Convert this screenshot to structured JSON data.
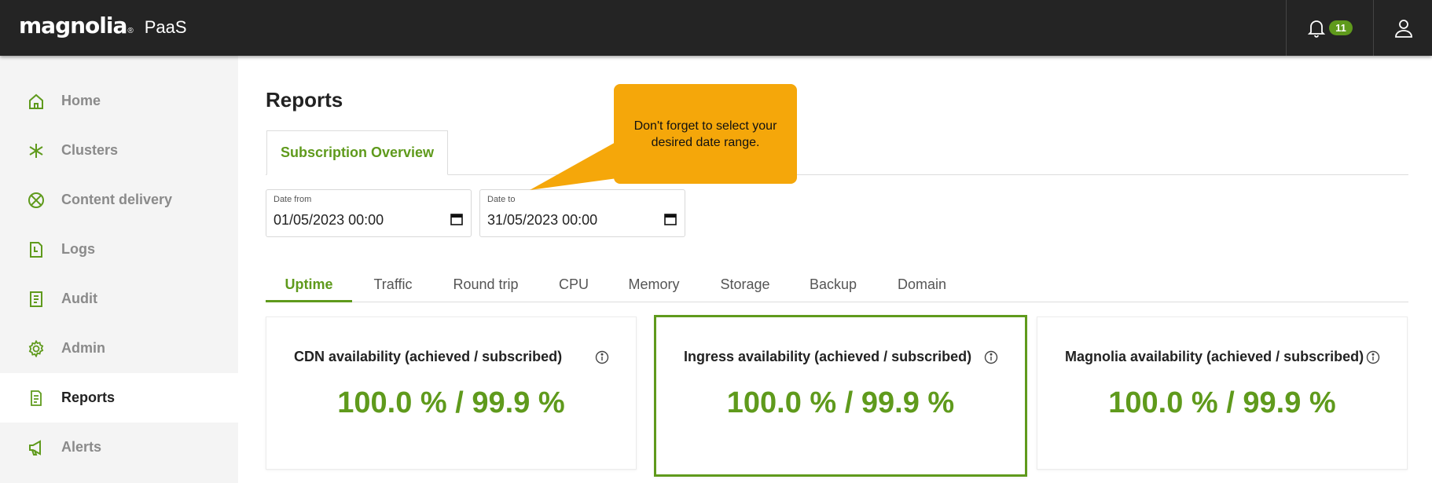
{
  "header": {
    "logo_text": "magnolia",
    "logo_reg": "®",
    "product": "PaaS",
    "notification_count": "11"
  },
  "sidebar": {
    "items": [
      {
        "label": "Home",
        "icon": "home-icon"
      },
      {
        "label": "Clusters",
        "icon": "asterisk-icon"
      },
      {
        "label": "Content delivery",
        "icon": "cdn-icon"
      },
      {
        "label": "Logs",
        "icon": "logs-icon"
      },
      {
        "label": "Audit",
        "icon": "audit-icon"
      },
      {
        "label": "Admin",
        "icon": "gear-icon"
      },
      {
        "label": "Reports",
        "icon": "reports-icon",
        "active": true
      },
      {
        "label": "Alerts",
        "icon": "megaphone-icon"
      }
    ]
  },
  "main": {
    "title": "Reports",
    "subtab": "Subscription Overview",
    "date_from": {
      "label": "Date from",
      "value": "01/05/2023 00:00"
    },
    "date_to": {
      "label": "Date to",
      "value": "31/05/2023 00:00"
    },
    "tooltip": "Don't forget to select your desired date range.",
    "tabs": [
      "Uptime",
      "Traffic",
      "Round trip",
      "CPU",
      "Memory",
      "Storage",
      "Backup",
      "Domain"
    ],
    "active_tab": "Uptime",
    "cards": [
      {
        "title": "CDN availability (achieved / subscribed)",
        "value": "100.0 % / 99.9 %"
      },
      {
        "title": "Ingress availability (achieved / subscribed)",
        "value": "100.0 % / 99.9 %",
        "highlighted": true
      },
      {
        "title": "Magnolia availability (achieved / subscribed)",
        "value": "100.0 % / 99.9 %"
      }
    ]
  },
  "colors": {
    "accent": "#5f9a1c",
    "topbar": "#242424",
    "tooltip": "#f5a70a"
  }
}
